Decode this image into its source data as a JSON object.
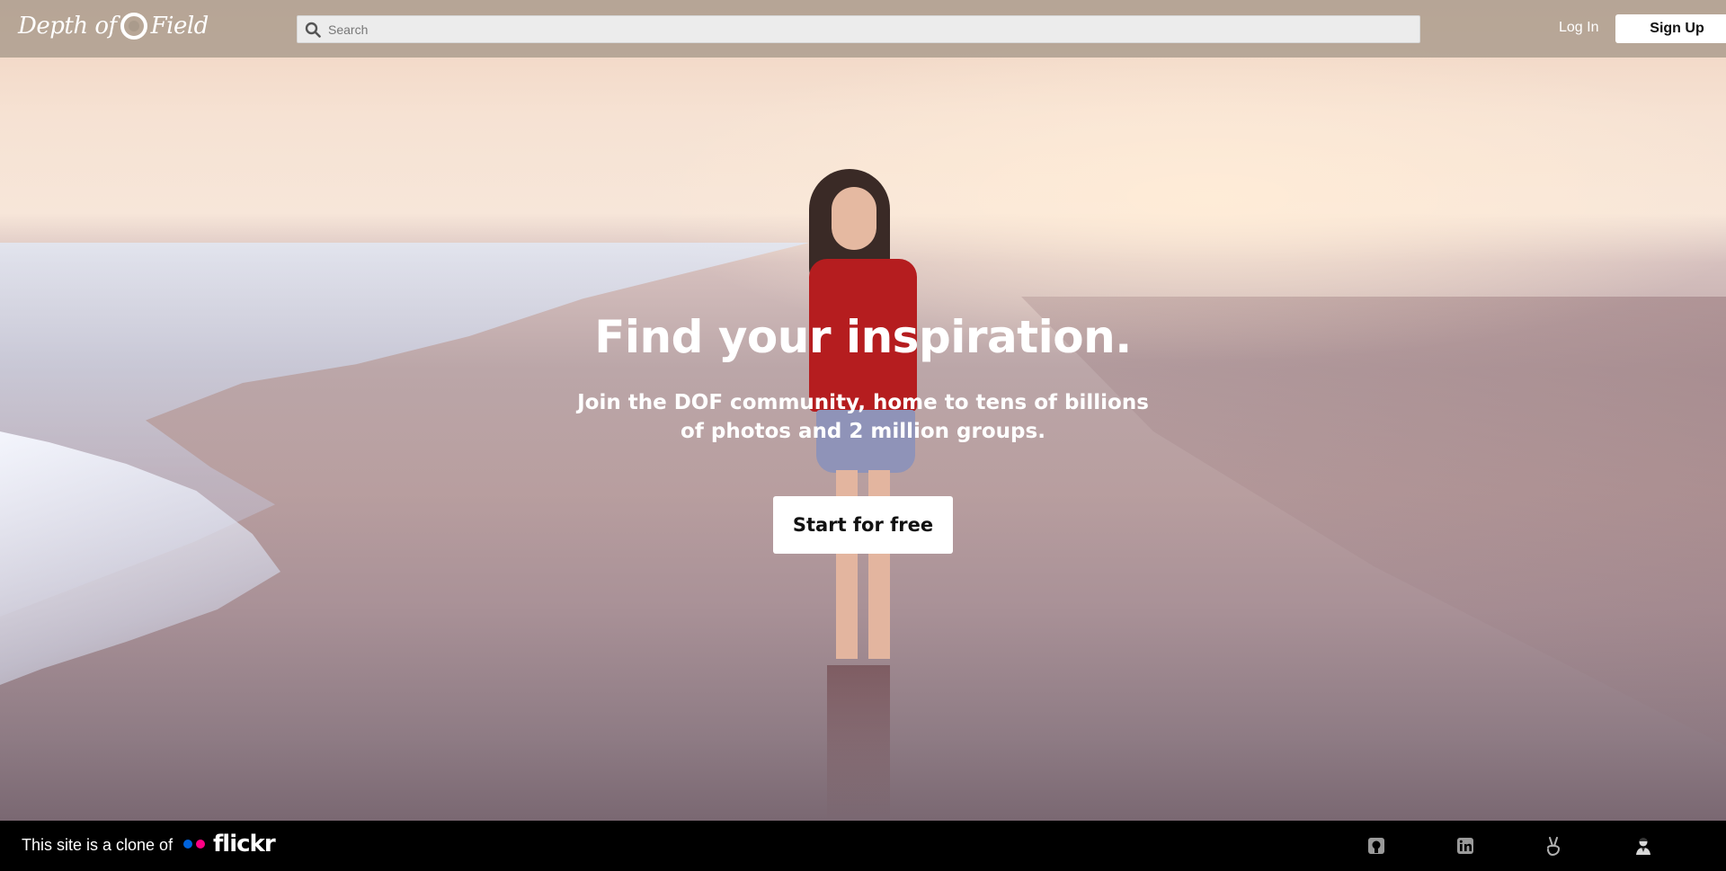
{
  "header": {
    "logo_text_left": "Depth of",
    "logo_text_right": "Field",
    "search": {
      "placeholder": "Search",
      "value": ""
    },
    "login_label": "Log In",
    "signup_label": "Sign Up"
  },
  "hero": {
    "title": "Find your inspiration.",
    "subtitle": "Join the DOF community, home to tens of billions of photos and 2 million groups.",
    "cta_label": "Start for free"
  },
  "footer": {
    "clone_text": "This site is a clone of",
    "flickr_wordmark": "flickr",
    "flickr_colors": [
      "#0063dc",
      "#ff0084"
    ],
    "social_icons": [
      "github-icon",
      "linkedin-icon",
      "angellist-icon",
      "portfolio-icon"
    ]
  },
  "colors": {
    "header_bg": "#aa9b8c",
    "footer_bg": "#000000",
    "button_bg": "#ffffff"
  }
}
